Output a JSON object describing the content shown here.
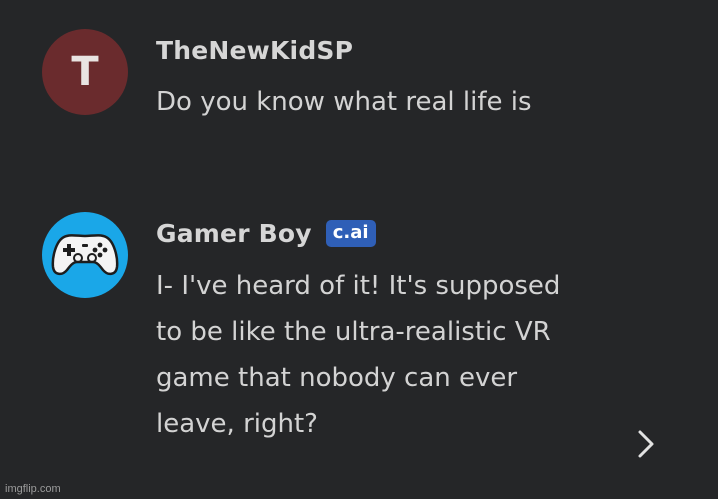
{
  "messages": [
    {
      "avatar_letter": "T",
      "avatar_color": "#6a2b2d",
      "name": "TheNewKidSP",
      "text_lines": [
        "Do you know what real life is"
      ]
    },
    {
      "avatar_icon": "game-controller-icon",
      "avatar_color": "#1aa7e8",
      "name": "Gamer Boy",
      "badge": "c.ai",
      "badge_color": "#2f5fb7",
      "text_lines": [
        "I- I've heard of it! It's supposed",
        "to be like the ultra-realistic VR",
        "game that nobody can ever",
        "leave, right?"
      ]
    }
  ],
  "next_icon": "chevron-right-icon",
  "watermark": "imgflip.com"
}
